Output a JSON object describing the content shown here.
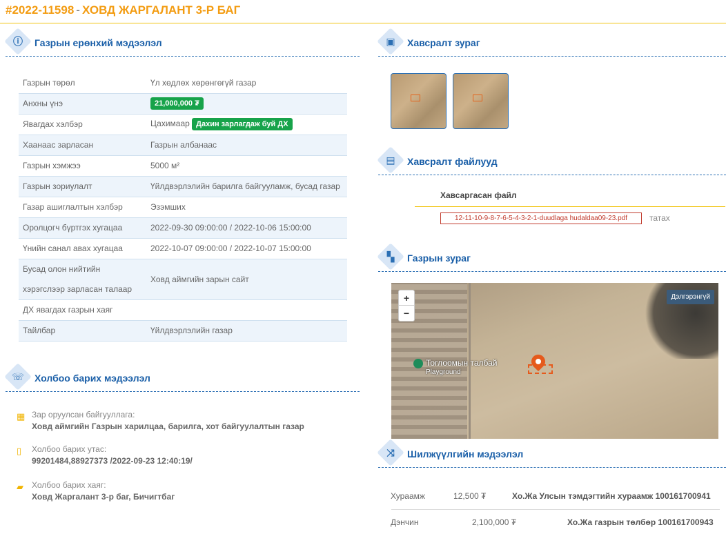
{
  "header": {
    "id": "#2022-11598",
    "separator": "-",
    "name": "ХОВД ЖАРГАЛАНТ 3-Р БАГ"
  },
  "general": {
    "title": "Газрын ерөнхий мэдээлэл",
    "icon": "info-icon",
    "rows": [
      {
        "k": "Газрын төрөл",
        "v": "Үл хөдлөх хөрөнгөгүй газар"
      },
      {
        "k": "Анхны үнэ",
        "v": "",
        "badge": "21,000,000 ₮"
      },
      {
        "k": "Явагдах хэлбэр",
        "v": "Цахимаар",
        "badge": "Дахин зарлагдаж буй ДХ"
      },
      {
        "k": "Хаанаас зарласан",
        "v": "Газрын албанаас"
      },
      {
        "k": "Газрын хэмжээ",
        "v": "5000 м²"
      },
      {
        "k": "Газрын зориулалт",
        "v": "Үйлдвэрлэлийн барилга байгууламж, бусад газар"
      },
      {
        "k": "Газар ашиглалтын хэлбэр",
        "v": "Эзэмших"
      },
      {
        "k": "Оролцогч бүртгэх хугацаа",
        "v": "2022-09-30 09:00:00 / 2022-10-06 15:00:00"
      },
      {
        "k": "Үнийн санал авах хугацаа",
        "v": "2022-10-07 09:00:00 / 2022-10-07 15:00:00"
      },
      {
        "k": "Бусад олон нийтийн хэрэгслээр зарласан талаар",
        "v": "Ховд аймгийн зарын сайт"
      },
      {
        "k": "ДХ явагдах газрын хаяг",
        "v": ""
      },
      {
        "k": "Тайлбар",
        "v": "Үйлдвэрлэлийн газар"
      }
    ]
  },
  "contact": {
    "title": "Холбоо барих мэдээлэл",
    "icon": "phone-icon",
    "org_label": "Зар оруулсан байгууллага:",
    "org_value": "Ховд аймгийн Газрын харилцаа, барилга, хот байгуулалтын газар",
    "phone_label": "Холбоо барих утас:",
    "phone_value": "99201484,88927373 /2022-09-23 12:40:19/",
    "address_label": "Холбоо барих хаяг:",
    "address_value": "Ховд Жаргалант 3-р баг, Бичигтбаг"
  },
  "photos": {
    "title": "Хавсралт зураг",
    "icon": "image-icon"
  },
  "files": {
    "title": "Хавсралт файлууд",
    "icon": "file-icon",
    "column": "Хавсаргасан файл",
    "file_name": "12-11-10-9-8-7-6-5-4-3-2-1-duudlaga hudaldaa09-23.pdf",
    "download": "татах"
  },
  "map": {
    "title": "Газрын зураг",
    "icon": "map-icon",
    "zoom_in": "+",
    "zoom_out": "−",
    "fullscreen": "Дэлгэрэнгүй",
    "poi_name": "Тоглоомын талбай",
    "poi_en": "Playground"
  },
  "transfer": {
    "title": "Шилжүүлгийн мэдээлэл",
    "icon": "shuffle-icon",
    "rows": [
      {
        "label": "Хураамж",
        "amount": "12,500 ₮",
        "account": "Хо.Жа Улсын тэмдэгтийн хураамж 100161700941"
      },
      {
        "label": "Дэнчин",
        "amount": "2,100,000 ₮",
        "account": "Хо.Жа газрын төлбөр 100161700943"
      }
    ]
  },
  "colors": {
    "accent": "#f39c12",
    "blue": "#1a5fa8",
    "green": "#17a34a"
  }
}
